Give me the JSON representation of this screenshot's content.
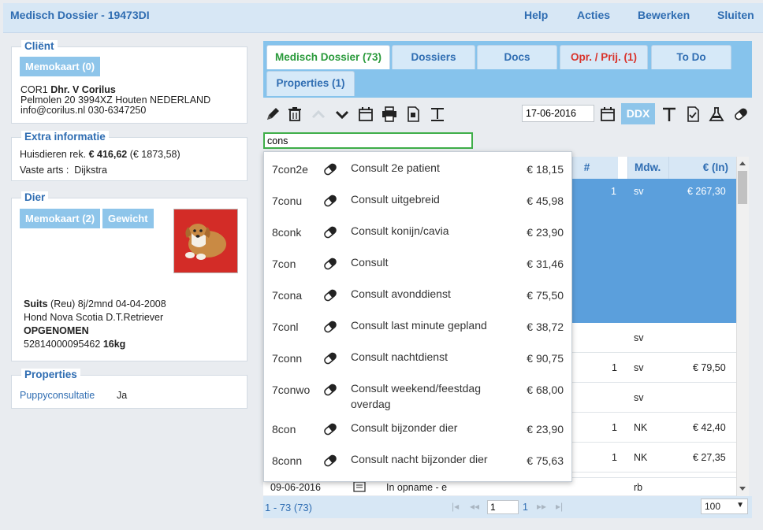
{
  "app": {
    "title": "Medisch Dossier - 19473DI"
  },
  "menu": {
    "help": "Help",
    "actions": "Acties",
    "edit": "Bewerken",
    "close": "Sluiten"
  },
  "client": {
    "legend": "Cliënt",
    "memokaart": "Memokaart (0)",
    "code": "COR1",
    "name": "Dhr. V Corilus",
    "address": "Pelmolen 20 3994XZ Houten NEDERLAND",
    "contact": "info@corilus.nl 030-6347250"
  },
  "extra": {
    "legend": "Extra informatie",
    "pet_account_label": "Huisdieren rek.",
    "pet_account_value": "€ 416,62",
    "pet_account_extra": "(€ 1873,58)",
    "vet_label": "Vaste arts :",
    "vet_value": "Dijkstra"
  },
  "animal": {
    "legend": "Dier",
    "memokaart": "Memokaart (2)",
    "weight_button": "Gewicht",
    "name": "Suits",
    "sex": "(Reu)",
    "age_birth": "8j/2mnd 04-04-2008",
    "breed": "Hond Nova Scotia D.T.Retriever",
    "status": "OPGENOMEN",
    "chip": "52814000095462",
    "weight": "16kg"
  },
  "properties": {
    "legend": "Properties",
    "key": "Puppyconsultatie",
    "value": "Ja"
  },
  "tabs": [
    {
      "label": "Medisch Dossier (73)"
    },
    {
      "label": "Dossiers"
    },
    {
      "label": "Docs"
    },
    {
      "label": "Opr. / Prij. (1)"
    },
    {
      "label": "To Do"
    },
    {
      "label": "Properties (1)"
    }
  ],
  "toolbar": {
    "date": "17-06-2016",
    "ddx": "DDX"
  },
  "search": {
    "value": "cons"
  },
  "grid": {
    "headers": {
      "count": "#",
      "employee": "Mdw.",
      "amount": "€ (In)"
    },
    "rows": [
      {
        "count": "1",
        "employee": "sv",
        "amount": "€ 267,30"
      },
      {
        "count": "",
        "employee": "sv",
        "amount": ""
      },
      {
        "count": "1",
        "employee": "sv",
        "amount": "€ 79,50"
      },
      {
        "count": "",
        "employee": "sv",
        "amount": ""
      },
      {
        "count": "1",
        "employee": "NK",
        "amount": "€ 42,40"
      },
      {
        "count": "1",
        "employee": "NK",
        "amount": "€ 27,35"
      },
      {
        "date": "09-06-2016",
        "desc": "In opname - e",
        "employee": "rb"
      }
    ]
  },
  "dropdown": [
    {
      "code": "7con2e",
      "desc": "Consult 2e patient",
      "price": "€ 18,15"
    },
    {
      "code": "7conu",
      "desc": "Consult uitgebreid",
      "price": "€ 45,98"
    },
    {
      "code": "8conk",
      "desc": "Consult konijn/cavia",
      "price": "€ 23,90"
    },
    {
      "code": "7con",
      "desc": "Consult",
      "price": "€ 31,46"
    },
    {
      "code": "7cona",
      "desc": "Consult avonddienst",
      "price": "€ 75,50"
    },
    {
      "code": "7conl",
      "desc": "Consult last minute gepland",
      "price": "€ 38,72"
    },
    {
      "code": "7conn",
      "desc": "Consult nachtdienst",
      "price": "€ 90,75"
    },
    {
      "code": "7conwo",
      "desc": "Consult weekend/feestdag overdag",
      "price": "€ 68,00"
    },
    {
      "code": "8con",
      "desc": "Consult bijzonder dier",
      "price": "€ 23,90"
    },
    {
      "code": "8conn",
      "desc": "Consult nacht bijzonder dier",
      "price": "€ 75,63"
    }
  ],
  "footer": {
    "range": "1 - 73 (",
    "total": "73",
    "range_end": ")",
    "page": "1",
    "pages": "1",
    "per_page": "100"
  },
  "colors": {
    "accent": "#2f6db2",
    "header_bg": "#86c3ec",
    "chip_bg": "#8ec5ea",
    "selected_row": "#5b9fdc",
    "active_tab_text": "#2a9a3b",
    "alert_text": "#d9342c"
  }
}
